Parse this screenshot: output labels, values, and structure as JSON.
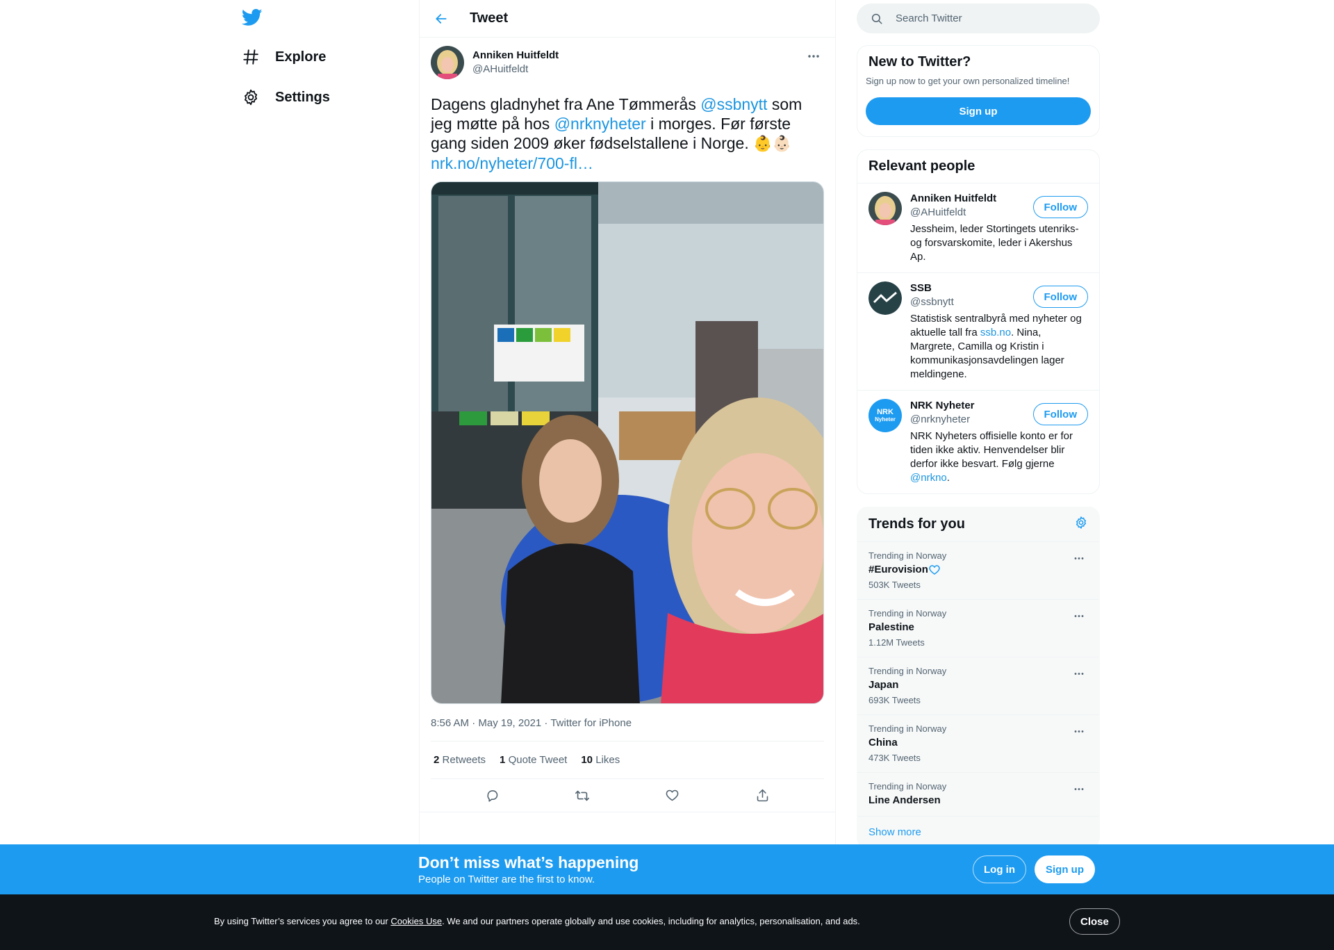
{
  "nav": {
    "items": [
      {
        "label": "Explore",
        "icon": "hashtag-icon"
      },
      {
        "label": "Settings",
        "icon": "gear-icon"
      }
    ]
  },
  "header": {
    "title": "Tweet"
  },
  "tweet": {
    "author_name": "Anniken Huitfeldt",
    "author_handle": "@AHuitfeldt",
    "text_parts": {
      "t1": "Dagens gladnyhet fra Ane Tømmerås ",
      "m1": "@ssbnytt",
      "t2": " som jeg møtte på hos ",
      "m2": "@nrknyheter",
      "t3": " i morges. Før første gang siden 2009 øker fødselstallene i Norge. ",
      "emoji": "👶👶🏻",
      "link": "nrk.no/nyheter/700-fl…"
    },
    "timestamp": "8:56 AM · May 19, 2021 · Twitter for iPhone",
    "stats": {
      "retweets_count": "2",
      "retweets_label": "Retweets",
      "quotes_count": "1",
      "quotes_label": "Quote Tweet",
      "likes_count": "10",
      "likes_label": "Likes"
    }
  },
  "search": {
    "placeholder": "Search Twitter"
  },
  "new_to_twitter": {
    "title": "New to Twitter?",
    "subtitle": "Sign up now to get your own personalized timeline!",
    "signup_label": "Sign up"
  },
  "relevant": {
    "title": "Relevant people",
    "follow_label": "Follow",
    "people": [
      {
        "name": "Anniken Huitfeldt",
        "handle": "@AHuitfeldt",
        "bio": "Jessheim, leder Stortingets utenriks- og forsvarskomite, leder i Akershus Ap."
      },
      {
        "name": "SSB",
        "handle": "@ssbnytt",
        "bio_a": "Statistisk sentralbyrå med nyheter og aktuelle tall fra ",
        "bio_link": "ssb.no",
        "bio_b": ". Nina, Margrete, Camilla og Kristin i kommunikasjonsavdelingen lager meldingene."
      },
      {
        "name": "NRK Nyheter",
        "handle": "@nrknyheter",
        "bio_a": "NRK Nyheters offisielle konto er for tiden ikke aktiv. Henvendelser blir derfor ikke besvart. Følg gjerne ",
        "bio_link": "@nrkno",
        "bio_b": ".",
        "avatar_text_1": "NRK",
        "avatar_text_2": "Nyheter"
      }
    ]
  },
  "trends": {
    "title": "Trends for you",
    "items": [
      {
        "context": "Trending in Norway",
        "name": "#Eurovision",
        "count": "503K Tweets"
      },
      {
        "context": "Trending in Norway",
        "name": "Palestine",
        "count": "1.12M Tweets"
      },
      {
        "context": "Trending in Norway",
        "name": "Japan",
        "count": "693K Tweets"
      },
      {
        "context": "Trending in Norway",
        "name": "China",
        "count": "473K Tweets"
      },
      {
        "context": "Trending in Norway",
        "name": "Line Andersen",
        "count": ""
      }
    ],
    "show_more": "Show more"
  },
  "banner": {
    "title": "Don’t miss what’s happening",
    "subtitle": "People on Twitter are the first to know.",
    "login_label": "Log in",
    "signup_label": "Sign up"
  },
  "cookie": {
    "text_a": "By using Twitter’s services you agree to our ",
    "link": "Cookies Use",
    "text_b": ". We and our partners operate globally and use cookies, including for analytics, personalisation, and ads.",
    "close_label": "Close"
  },
  "colors": {
    "accent": "#1d9bf0",
    "text": "#0f1419",
    "muted": "#536471",
    "dark": "#0f1419"
  }
}
